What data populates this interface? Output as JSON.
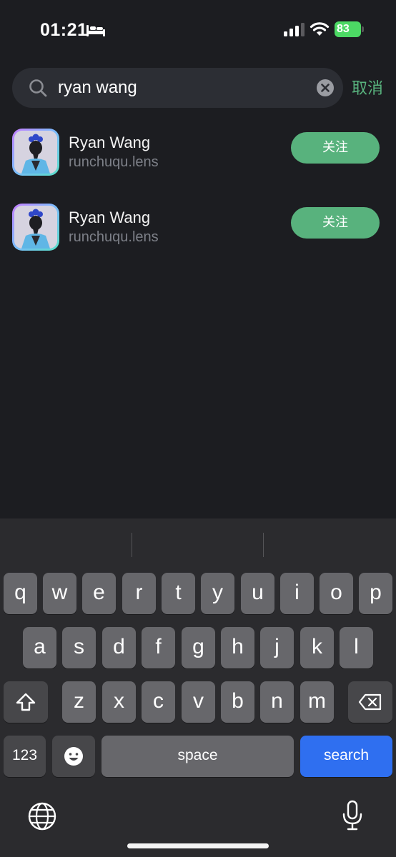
{
  "status_bar": {
    "time": "01:21",
    "battery_level": "83"
  },
  "search": {
    "query": "ryan wang",
    "cancel_label": "取消"
  },
  "results": [
    {
      "name": "Ryan Wang",
      "handle": "runchuqu.lens",
      "follow_label": "关注"
    },
    {
      "name": "Ryan Wang",
      "handle": "runchuqu.lens",
      "follow_label": "关注"
    }
  ],
  "keyboard": {
    "row1": [
      "q",
      "w",
      "e",
      "r",
      "t",
      "y",
      "u",
      "i",
      "o",
      "p"
    ],
    "row2": [
      "a",
      "s",
      "d",
      "f",
      "g",
      "h",
      "j",
      "k",
      "l"
    ],
    "row3": [
      "z",
      "x",
      "c",
      "v",
      "b",
      "n",
      "m"
    ],
    "numbers_label": "123",
    "space_label": "space",
    "action_label": "search"
  },
  "colors": {
    "accent_green": "#58b27d",
    "background": "#1c1d21",
    "keyboard_bg": "#2b2b2e",
    "search_key_blue": "#2f6ff0"
  }
}
